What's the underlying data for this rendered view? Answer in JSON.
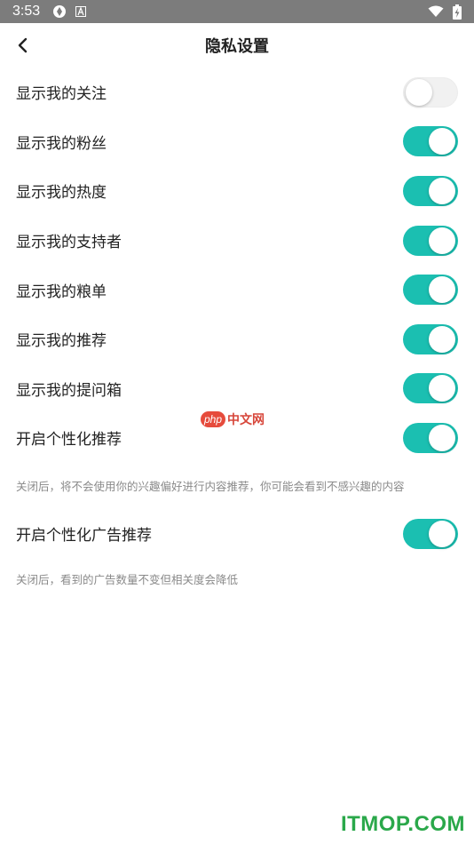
{
  "status_bar": {
    "time": "3:53",
    "icons": [
      "sync-icon",
      "a-icon",
      "wifi-icon",
      "battery-charging-icon"
    ]
  },
  "header": {
    "title": "隐私设置"
  },
  "settings": [
    {
      "label": "显示我的关注",
      "enabled": false
    },
    {
      "label": "显示我的粉丝",
      "enabled": true
    },
    {
      "label": "显示我的热度",
      "enabled": true
    },
    {
      "label": "显示我的支持者",
      "enabled": true
    },
    {
      "label": "显示我的粮单",
      "enabled": true
    },
    {
      "label": "显示我的推荐",
      "enabled": true
    },
    {
      "label": "显示我的提问箱",
      "enabled": true
    },
    {
      "label": "开启个性化推荐",
      "enabled": true
    }
  ],
  "personalized_hint": "关闭后，将不会使用你的兴趣偏好进行内容推荐，你可能会看到不感兴趣的内容",
  "ad_setting": {
    "label": "开启个性化广告推荐",
    "enabled": true
  },
  "ad_hint": "关闭后，看到的广告数量不变但相关度会降低",
  "watermarks": {
    "php_badge": "php",
    "php_text": "中文网",
    "site": "ITMOP.COM"
  },
  "colors": {
    "switch_on": "#1bbfb1",
    "switch_off": "#f1f1f1",
    "status_bar": "#7c7c7c"
  }
}
